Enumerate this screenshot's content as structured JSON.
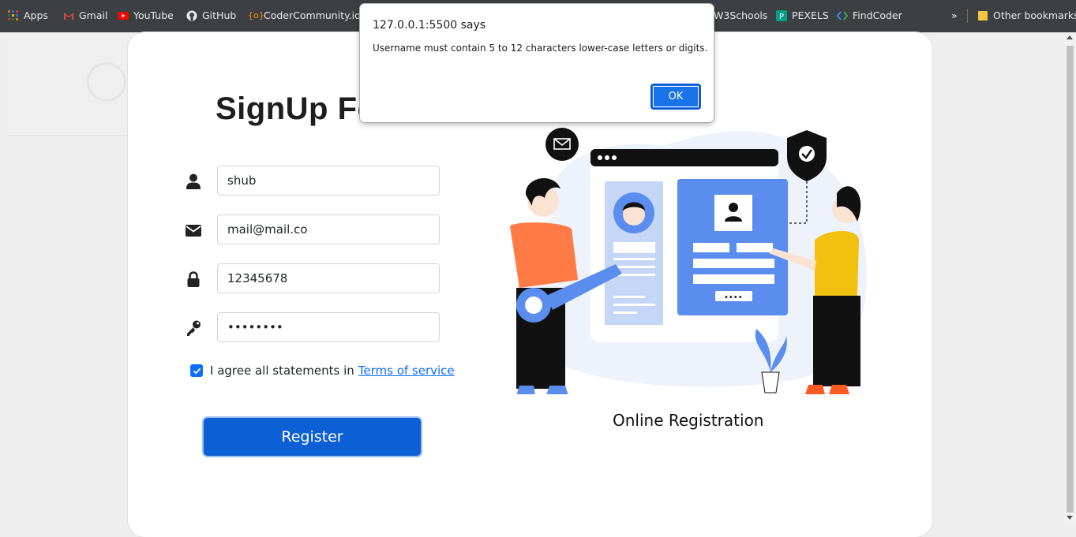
{
  "bookmarks": {
    "items": [
      {
        "label": "Apps",
        "icon": "apps-grid-icon"
      },
      {
        "label": "Gmail",
        "icon": "gmail-icon"
      },
      {
        "label": "YouTube",
        "icon": "youtube-icon"
      },
      {
        "label": "GitHub",
        "icon": "github-icon"
      },
      {
        "label": "CoderCommunity.io",
        "icon": "codercommunity-icon"
      },
      {
        "label": "W3Schools",
        "icon": "w3schools-icon"
      },
      {
        "label": "PEXELS",
        "icon": "pexels-icon"
      },
      {
        "label": "FindCoder",
        "icon": "findcoder-icon"
      }
    ],
    "more": "»",
    "other": "Other bookmarks"
  },
  "form": {
    "title": "SignUp Fo",
    "username": "shub",
    "email": "mail@mail.co",
    "password": "12345678",
    "confirm": "••••••••",
    "agree_text": "I agree all statements in",
    "terms_link": "Terms of service",
    "register_label": "Register"
  },
  "illustration": {
    "caption": "Online Registration"
  },
  "dialog": {
    "origin": "127.0.0.1:5500 says",
    "message": "Username must contain 5 to 12 characters lower-case letters or digits.",
    "ok_label": "OK"
  },
  "colors": {
    "accent": "#0d6efd",
    "register": "#0d5fd6",
    "illustration_blue": "#5b8def",
    "orange": "#ff7a45",
    "yellow": "#f2c10f"
  }
}
